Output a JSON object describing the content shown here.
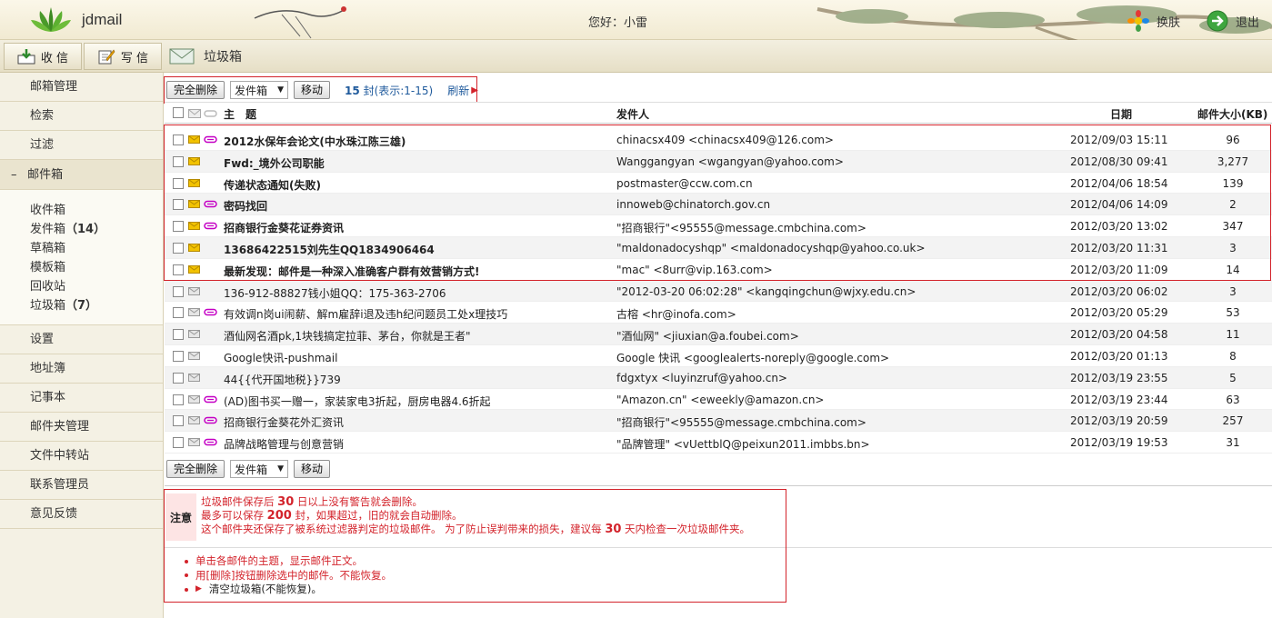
{
  "app": {
    "name": "jdmail"
  },
  "header": {
    "greeting": "您好：小雷",
    "skin_label": "换肤",
    "exit_label": "退出"
  },
  "toolbar": {
    "receive_label": "收 信",
    "write_label": "写 信",
    "folder_title": "垃圾箱"
  },
  "sidebar": {
    "mailbox_manage": "邮箱管理",
    "check": "检索",
    "filter": "过滤",
    "mailbox_section": "邮件箱",
    "folders": [
      {
        "label": "收件箱",
        "count": ""
      },
      {
        "label": "发件箱",
        "count": "（14）"
      },
      {
        "label": "草稿箱",
        "count": ""
      },
      {
        "label": "模板箱",
        "count": ""
      },
      {
        "label": "回收站",
        "count": ""
      },
      {
        "label": "垃圾箱",
        "count": "（7）"
      }
    ],
    "items": [
      "设置",
      "地址簿",
      "记事本",
      "邮件夹管理",
      "文件中转站",
      "联系管理员",
      "意见反馈"
    ]
  },
  "actions": {
    "delete_label": "完全删除",
    "target_folder": "发件箱",
    "move_label": "移动",
    "count_num": "15",
    "count_text": "封(表示:1-15)",
    "refresh_label": "刷新"
  },
  "table": {
    "headers": {
      "subject": "主　题",
      "from": "发件人",
      "date": "日期",
      "size": "邮件大小(KB)"
    },
    "rows": [
      {
        "subject": "2012水保年会论文(中水珠江陈三雄)",
        "from": "chinacsx409 <chinacsx409@126.com>",
        "date": "2012/09/03 15:11",
        "size": "96",
        "unread": true,
        "attach": true
      },
      {
        "subject": "Fwd:_境外公司职能",
        "from": "Wanggangyan <wgangyan@yahoo.com>",
        "date": "2012/08/30 09:41",
        "size": "3,277",
        "unread": true,
        "attach": false
      },
      {
        "subject": "传递状态通知(失败)",
        "from": "postmaster@ccw.com.cn",
        "date": "2012/04/06 18:54",
        "size": "139",
        "unread": true,
        "attach": false
      },
      {
        "subject": "密码找回",
        "from": "innoweb@chinatorch.gov.cn",
        "date": "2012/04/06 14:09",
        "size": "2",
        "unread": true,
        "attach": true
      },
      {
        "subject": "招商银行金葵花证券资讯",
        "from": "\"招商银行\"<95555@message.cmbchina.com>",
        "date": "2012/03/20 13:02",
        "size": "347",
        "unread": true,
        "attach": true
      },
      {
        "subject": "13686422515刘先生QQ1834906464",
        "from": "\"maldonadocyshqp\" <maldonadocyshqp@yahoo.co.uk>",
        "date": "2012/03/20 11:31",
        "size": "3",
        "unread": true,
        "attach": false
      },
      {
        "subject": "最新发现：邮件是一种深入准确客户群有效营销方式!",
        "from": "\"mac\" <8urr@vip.163.com>",
        "date": "2012/03/20 11:09",
        "size": "14",
        "unread": true,
        "attach": false
      },
      {
        "subject": "136-912-88827钱小姐QQ：175-363-2706",
        "from": "\"2012-03-20 06:02:28\" <kangqingchun@wjxy.edu.cn>",
        "date": "2012/03/20 06:02",
        "size": "3",
        "unread": false,
        "attach": false
      },
      {
        "subject": "有效调n岗ui闹薪、解m雇辞i退及违h纪问题员工处x理技巧",
        "from": "古榕 <hr@inofa.com>",
        "date": "2012/03/20 05:29",
        "size": "53",
        "unread": false,
        "attach": true
      },
      {
        "subject": "酒仙网名酒pk,1块钱搞定拉菲、茅台，你就是王者\"",
        "from": "\"酒仙网\" <jiuxian@a.foubei.com>",
        "date": "2012/03/20 04:58",
        "size": "11",
        "unread": false,
        "attach": false
      },
      {
        "subject": "Google快讯-pushmail",
        "from": "Google 快讯 <googlealerts-noreply@google.com>",
        "date": "2012/03/20 01:13",
        "size": "8",
        "unread": false,
        "attach": false
      },
      {
        "subject": "44{{代开国地税}}739",
        "from": "fdgxtyx <luyinzruf@yahoo.cn>",
        "date": "2012/03/19 23:55",
        "size": "5",
        "unread": false,
        "attach": false
      },
      {
        "subject": "(AD)图书买一赠一，家装家电3折起，厨房电器4.6折起",
        "from": "\"Amazon.cn\" <eweekly@amazon.cn>",
        "date": "2012/03/19 23:44",
        "size": "63",
        "unread": false,
        "attach": true
      },
      {
        "subject": "招商银行金葵花外汇资讯",
        "from": "\"招商银行\"<95555@message.cmbchina.com>",
        "date": "2012/03/19 20:59",
        "size": "257",
        "unread": false,
        "attach": true
      },
      {
        "subject": "品牌战略管理与创意营销",
        "from": "\"品牌管理\" <vUettblQ@peixun2011.imbbs.bn>",
        "date": "2012/03/19 19:53",
        "size": "31",
        "unread": false,
        "attach": true
      }
    ]
  },
  "notice": {
    "label": "注意",
    "line1_a": "垃圾邮件保存后 ",
    "line1_num": "30",
    "line1_b": " 日以上没有警告就会删除。",
    "line2_a": "最多可以保存 ",
    "line2_num": "200",
    "line2_b": " 封，如果超过，旧的就会自动删除。",
    "line3_a": "这个邮件夹还保存了被系统过滤器判定的垃圾邮件。 为了防止误判带来的损失，建议每 ",
    "line3_num": "30",
    "line3_b": " 天内检查一次垃圾邮件夹。",
    "tip1": "单击各邮件的主题，显示邮件正文。",
    "tip2": "用[删除]按钮删除选中的邮件。不能恢复。",
    "tip3": "清空垃圾箱(不能恢复)。"
  },
  "colors": {
    "accent_red": "#d3232b",
    "link_blue": "#1f5a9c",
    "envelope": "#f2c200",
    "clip": "#c400c4"
  }
}
